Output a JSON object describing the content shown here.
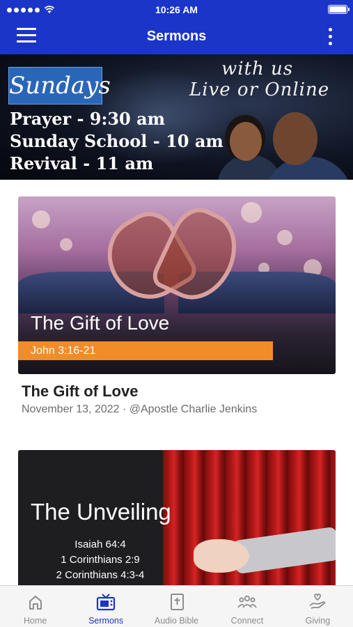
{
  "status_bar": {
    "time": "10:26 AM"
  },
  "nav": {
    "title": "Sermons"
  },
  "banner": {
    "sundays": "Sundays",
    "with_us": "with us",
    "live_online": "Live or Online",
    "schedule": [
      "Prayer - 9:30 am",
      "Sunday School - 10 am",
      "Revival - 11 am"
    ]
  },
  "sermons": [
    {
      "thumb_title": "The Gift of Love",
      "scripture": "John 3:16-21",
      "title": "The Gift of Love",
      "meta": "November 13, 2022 · @Apostle Charlie Jenkins"
    },
    {
      "thumb_title": "The Unveiling",
      "references": [
        "Isaiah 64:4",
        "1 Corinthians 2:9",
        "2 Corinthians 4:3-4"
      ]
    }
  ],
  "tabs": [
    {
      "label": "Home",
      "icon": "home-icon"
    },
    {
      "label": "Sermons",
      "icon": "tv-icon"
    },
    {
      "label": "Audio Bible",
      "icon": "bible-icon"
    },
    {
      "label": "Connect",
      "icon": "people-icon"
    },
    {
      "label": "Giving",
      "icon": "giving-hand-icon"
    }
  ],
  "colors": {
    "brand": "#1b35c9",
    "accent": "#f28c28",
    "tab_inactive": "#8c8c8c"
  }
}
